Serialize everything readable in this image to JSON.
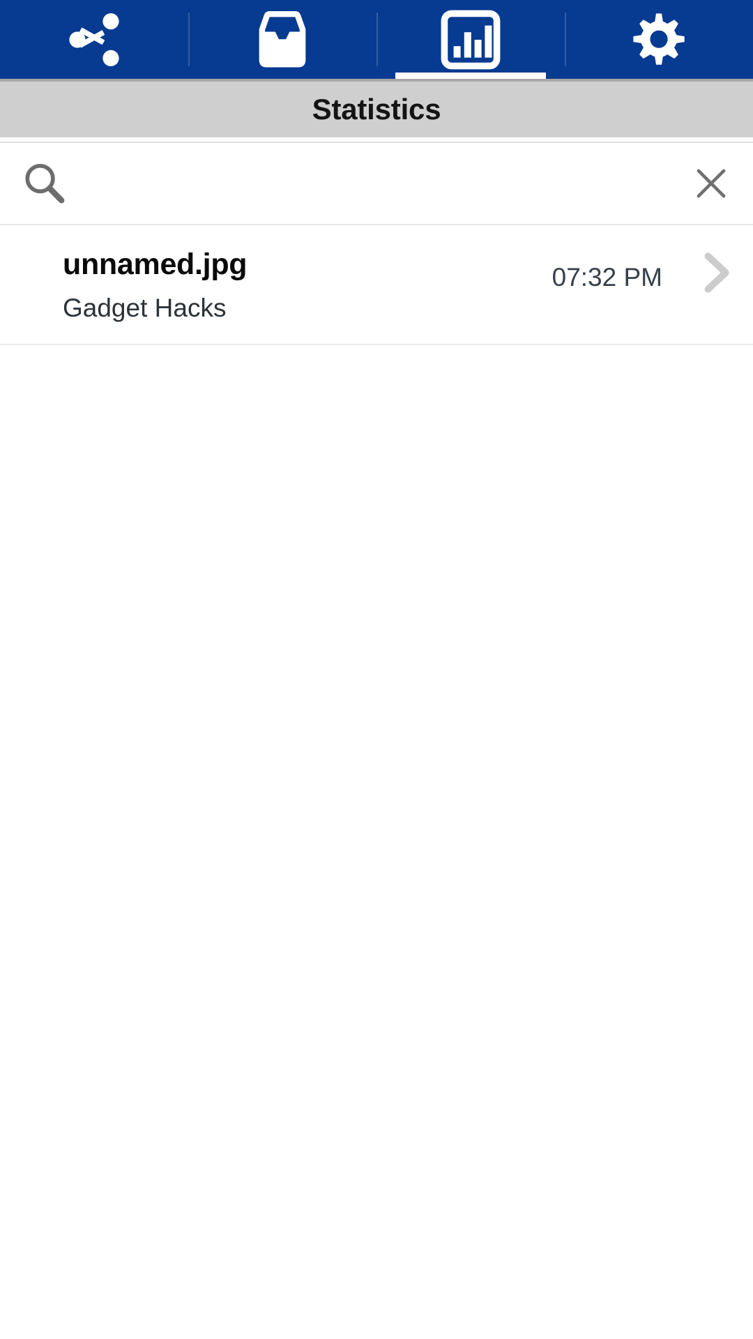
{
  "app": {
    "accent_color": "#073a91",
    "titlebar_color": "#cfcfcf",
    "background_color": "#ffffff"
  },
  "tabbar": {
    "items": [
      {
        "id": "share",
        "icon": "share-icon",
        "label": "Share",
        "active": false
      },
      {
        "id": "inbox",
        "icon": "inbox-tray-icon",
        "label": "Inbox",
        "active": false
      },
      {
        "id": "statistics",
        "icon": "bar-chart-icon",
        "label": "Statistics",
        "active": true
      },
      {
        "id": "settings",
        "icon": "gear-icon",
        "label": "Settings",
        "active": false
      }
    ]
  },
  "header": {
    "title": "Statistics"
  },
  "search": {
    "icon": "search-icon",
    "value": "",
    "placeholder": "",
    "clear_icon": "close-icon"
  },
  "list": {
    "items": [
      {
        "title": "unnamed.jpg",
        "subtitle": "Gadget Hacks",
        "time": "07:32 PM",
        "chevron": "chevron-right-icon"
      }
    ]
  }
}
